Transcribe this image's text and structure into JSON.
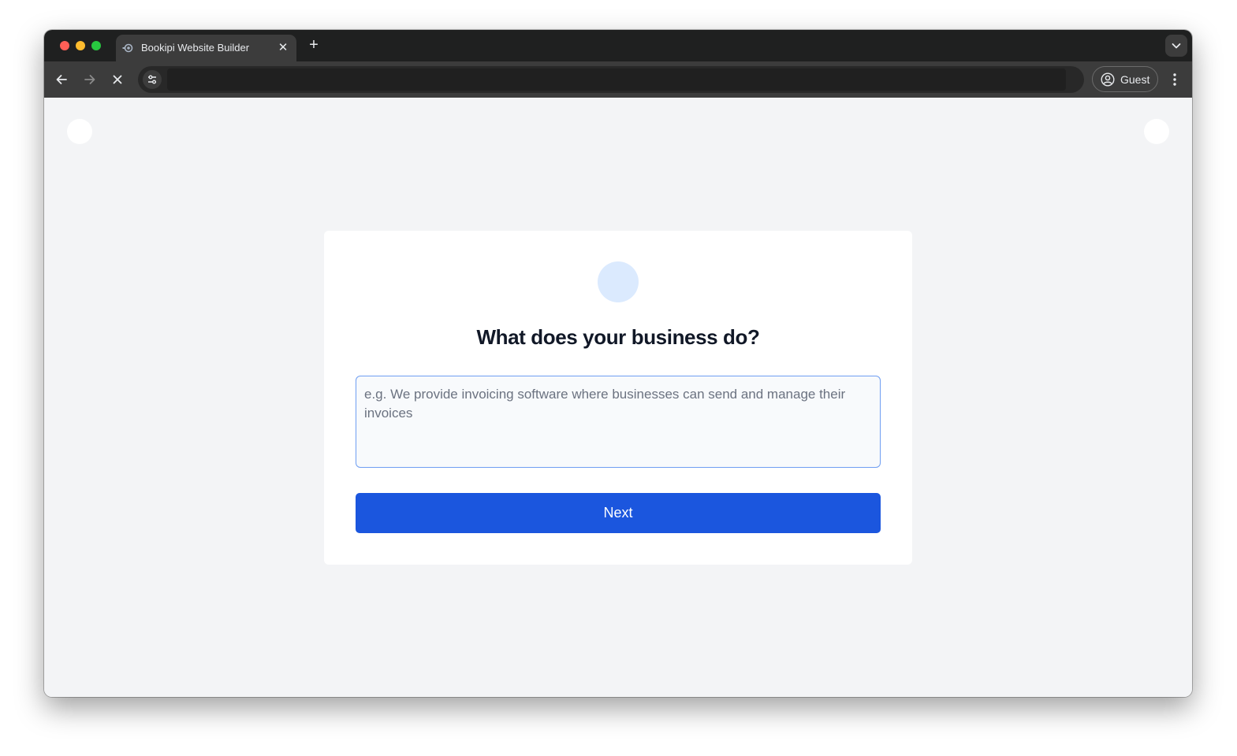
{
  "browser": {
    "tab_title": "Bookipi Website Builder",
    "tab_close": "✕",
    "new_tab": "+",
    "address": "",
    "profile_label": "Guest"
  },
  "form": {
    "title": "What does your business do?",
    "placeholder": "e.g. We provide invoicing software where businesses can send and manage their invoices",
    "value": "",
    "next_label": "Next"
  },
  "colors": {
    "accent": "#1b56de",
    "input_border": "#6f9ef2",
    "icon_circle": "#dbeafe",
    "page_bg": "#f3f4f6"
  },
  "icons": {
    "back": "arrow-left-icon",
    "forward": "arrow-right-icon",
    "stop": "close-icon",
    "site_info": "tune-icon",
    "profile": "person-circle-icon",
    "menu": "more-vert-icon"
  }
}
